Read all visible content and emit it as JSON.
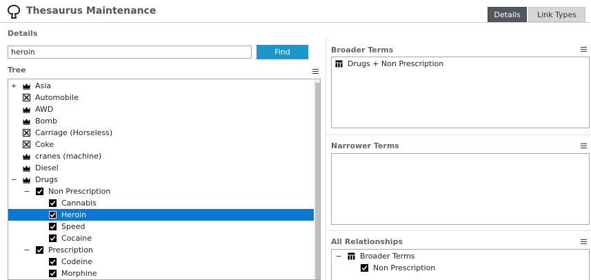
{
  "app": {
    "title": "Thesaurus Maintenance",
    "tabs": [
      {
        "label": "Details",
        "active": true
      },
      {
        "label": "Link Types",
        "active": false
      }
    ]
  },
  "details": {
    "section_label": "Details",
    "search": {
      "value": "heroin",
      "placeholder": ""
    },
    "find_label": "Find"
  },
  "tree": {
    "label": "Tree",
    "rows": [
      {
        "label": "Asia",
        "toggle": "+",
        "icon": "crown-icon",
        "level": 0
      },
      {
        "label": "Automobile",
        "toggle": "",
        "icon": "unchecked-box-icon",
        "level": 0
      },
      {
        "label": "AWD",
        "toggle": "",
        "icon": "crown-icon",
        "level": 0
      },
      {
        "label": "Bomb",
        "toggle": "",
        "icon": "crown-icon",
        "level": 0
      },
      {
        "label": "Carriage (Horseless)",
        "toggle": "",
        "icon": "unchecked-box-icon",
        "level": 0
      },
      {
        "label": "Coke",
        "toggle": "",
        "icon": "unchecked-box-icon",
        "level": 0
      },
      {
        "label": "cranes (machine)",
        "toggle": "",
        "icon": "crown-icon",
        "level": 0
      },
      {
        "label": "Diesel",
        "toggle": "",
        "icon": "crown-icon",
        "level": 0
      },
      {
        "label": "Drugs",
        "toggle": "−",
        "icon": "crown-icon",
        "level": 0
      },
      {
        "label": "Non Prescription",
        "toggle": "−",
        "icon": "checked-box-icon",
        "level": 1
      },
      {
        "label": "Cannabis",
        "toggle": "",
        "icon": "checked-box-icon",
        "level": 2
      },
      {
        "label": "Heroin",
        "toggle": "",
        "icon": "checked-box-icon",
        "level": 2,
        "selected": true
      },
      {
        "label": "Speed",
        "toggle": "",
        "icon": "checked-box-icon",
        "level": 2
      },
      {
        "label": "Cocaine",
        "toggle": "",
        "icon": "checked-box-icon",
        "level": 2
      },
      {
        "label": "Prescription",
        "toggle": "−",
        "icon": "checked-box-icon",
        "level": 1
      },
      {
        "label": "Codeine",
        "toggle": "",
        "icon": "checked-box-icon",
        "level": 2
      },
      {
        "label": "Morphine",
        "toggle": "",
        "icon": "checked-box-icon",
        "level": 2
      }
    ]
  },
  "broader_terms": {
    "label": "Broader Terms",
    "items": [
      {
        "label": "Drugs + Non Prescription",
        "icon": "hierarchy-icon"
      }
    ]
  },
  "narrower_terms": {
    "label": "Narrower Terms",
    "items": []
  },
  "all_relationships": {
    "label": "All Relationships",
    "items": [
      {
        "label": "Broader Terms",
        "toggle": "−",
        "icon": "hierarchy-icon",
        "level": 0
      },
      {
        "label": "Non Prescription",
        "toggle": "",
        "icon": "checked-box-icon",
        "level": 1
      }
    ]
  },
  "colors": {
    "accent": "#1a96c8",
    "selection": "#0a78d7",
    "tab_active": "#52585f",
    "tab_inactive": "#d4d6d8"
  }
}
